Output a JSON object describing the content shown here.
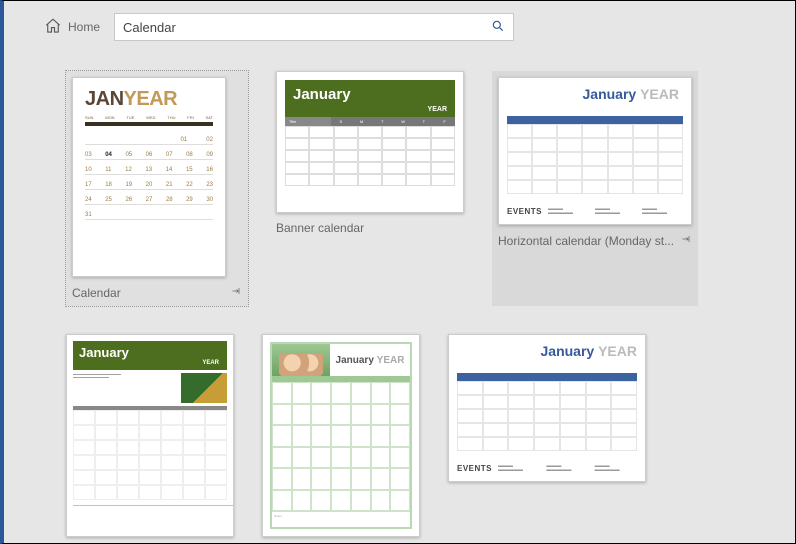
{
  "header": {
    "home_label": "Home",
    "search_value": "Calendar"
  },
  "templates": [
    {
      "label": "Calendar",
      "selected": true,
      "pinned": true
    },
    {
      "label": "Banner calendar"
    },
    {
      "label": "Horizontal calendar (Monday st...",
      "hovered": true,
      "pinned": true
    },
    {
      "label": ""
    },
    {
      "label": ""
    },
    {
      "label": ""
    }
  ],
  "thumb_text": {
    "jan": "JAN",
    "year": "YEAR",
    "january": "January",
    "events": "EVENTS",
    "title": "Title"
  }
}
